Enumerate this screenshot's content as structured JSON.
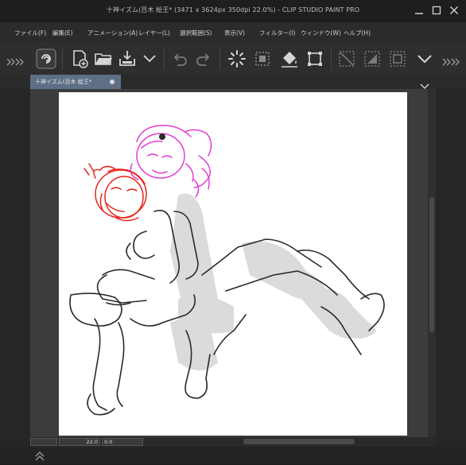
{
  "window": {
    "title": "十神イズム(百木 絵王* (3471 x 3624px 350dpi 22.0%) - CLIP STUDIO PAINT PRO",
    "minimize_icon": "minimize-icon",
    "maximize_icon": "maximize-icon",
    "close_icon": "close-icon"
  },
  "menu": {
    "items": [
      {
        "label": "ファイル(F)"
      },
      {
        "label": "編集(E)"
      },
      {
        "label": "アニメーション(A)"
      },
      {
        "label": "レイヤー(L)"
      },
      {
        "label": "選択範囲(S)"
      },
      {
        "label": "表示(V)"
      },
      {
        "label": "フィルター(I)"
      },
      {
        "label": "ウィンドウ(W)"
      },
      {
        "label": "ヘルプ(H)"
      }
    ]
  },
  "toolbar": {
    "icons": [
      "clip-studio-logo-icon",
      "new-file-icon",
      "open-folder-icon",
      "save-icon",
      "chevron-down-icon",
      "undo-icon",
      "redo-icon",
      "loading-spinner-icon",
      "select-area-icon",
      "fill-icon",
      "transform-icon",
      "clear-selection-icon",
      "invert-selection-icon",
      "show-selection-icon",
      "chevron-down-icon"
    ]
  },
  "tab": {
    "label": "十神イズム(百木 絵王*"
  },
  "status": {
    "zoom": "22.0",
    "angle": "0.0"
  },
  "colors": {
    "background": "#1e1e1e",
    "menubar": "#2b2b2b",
    "toolbar": "#2e2e2e",
    "tab_active": "#5f6f86",
    "workspace": "#3c3c3c",
    "canvas": "#ffffff",
    "sketch_red": "#e8231c",
    "sketch_magenta": "#e23cd2"
  }
}
